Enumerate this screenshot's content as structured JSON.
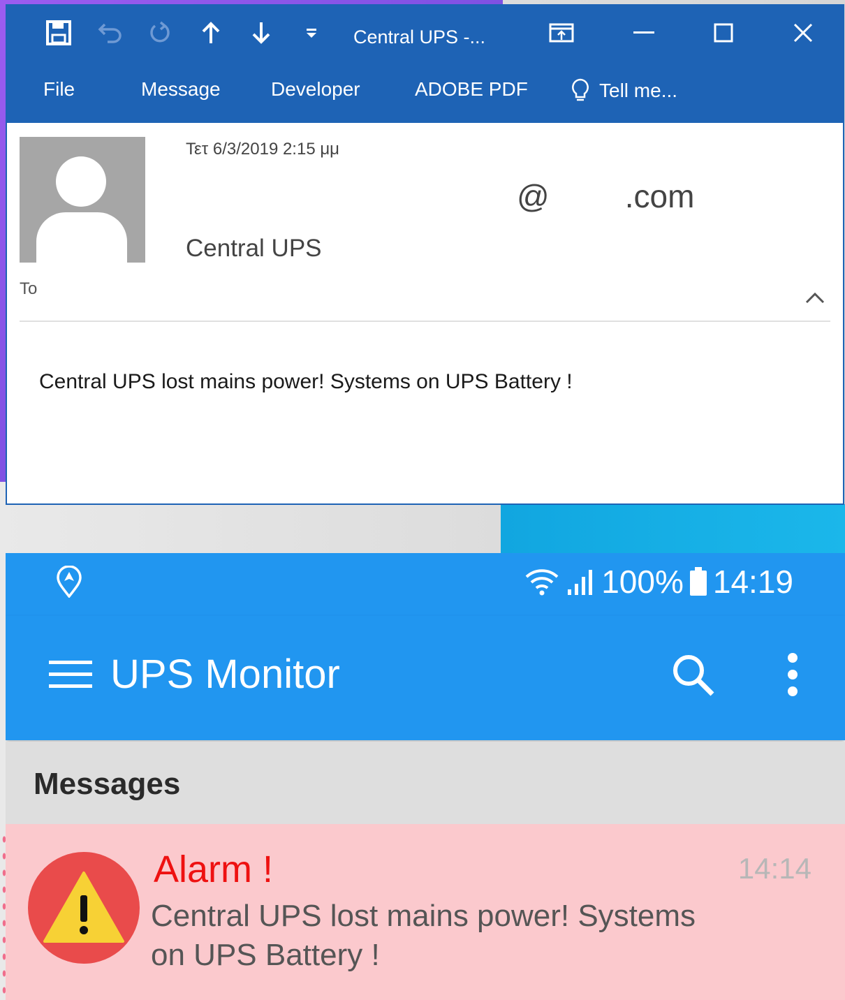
{
  "outlook": {
    "quick_access": {
      "save_icon": "save-icon",
      "undo_icon": "undo-icon",
      "redo_icon": "redo-icon",
      "previous_icon": "arrow-up-icon",
      "next_icon": "arrow-down-icon",
      "customize_icon": "customize-dropdown-icon"
    },
    "window_title": "Central UPS -...",
    "window_controls": [
      "ribbon-display-icon",
      "minimize-icon",
      "maximize-icon",
      "close-icon"
    ],
    "tabs": [
      "File",
      "Message",
      "Developer",
      "ADOBE PDF"
    ],
    "tell_me": "Tell me...",
    "email": {
      "date": "Τετ 6/3/2019 2:15 μμ",
      "from_at": "@",
      "from_domain": ".com",
      "sender_name": "Central UPS",
      "to_label": "To",
      "body": "Central UPS lost mains power! Systems on UPS Battery !"
    },
    "accent_color": "#1e63b5"
  },
  "android": {
    "status_bar": {
      "battery": "100%",
      "time": "14:19"
    },
    "app_title": "UPS Monitor",
    "section_title": "Messages",
    "message": {
      "title": "Alarm !",
      "time": "14:14",
      "body": "Central UPS lost mains power! Systems on UPS Battery !"
    },
    "colors": {
      "primary": "#2196f0",
      "alarm_bg": "#fbc9cd",
      "alarm_title": "#ee1111"
    }
  }
}
